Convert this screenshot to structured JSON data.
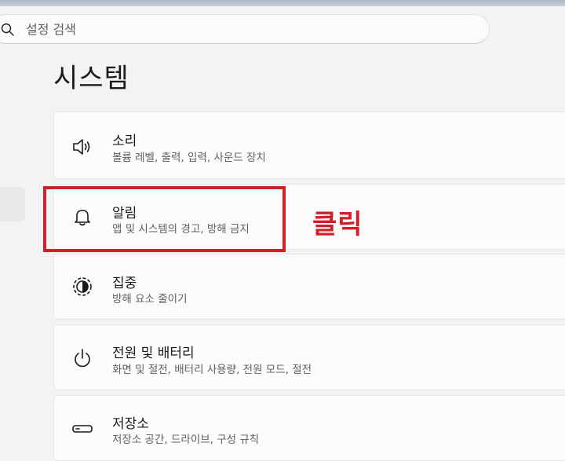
{
  "search": {
    "placeholder": "설정 검색"
  },
  "page": {
    "title": "시스템"
  },
  "cards": [
    {
      "title": "소리",
      "description": "볼륨 레벨, 출력, 입력, 사운드 장치",
      "icon": "speaker-icon"
    },
    {
      "title": "알림",
      "description": "앱 및 시스템의 경고, 방해 금지",
      "icon": "bell-icon"
    },
    {
      "title": "집중",
      "description": "방해 요소 줄이기",
      "icon": "focus-icon"
    },
    {
      "title": "전원 및 배터리",
      "description": "화면 및 절전, 배터리 사용량, 전원 모드, 절전",
      "icon": "power-icon"
    },
    {
      "title": "저장소",
      "description": "저장소 공간, 드라이브, 구성 규칙",
      "icon": "storage-icon"
    }
  ],
  "annotation": {
    "text": "클릭",
    "color": "#d0202a"
  },
  "colors": {
    "background": "#f3f3f3",
    "card": "#fbfbfb",
    "highlight": "#d0202a"
  }
}
